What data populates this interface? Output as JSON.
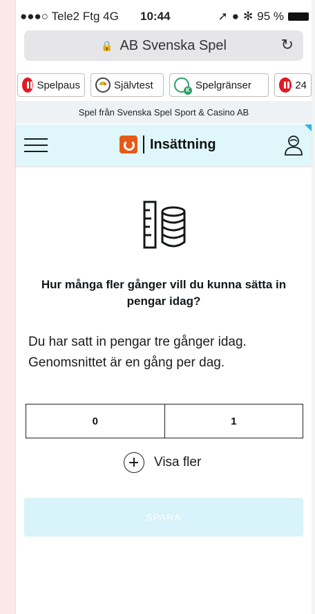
{
  "status_bar": {
    "carrier": "●●●○ Tele2 Ftg  4G",
    "time": "10:44",
    "right_text": "95 %"
  },
  "browser": {
    "site_name": "AB Svenska Spel",
    "lock_icon": "lock-icon",
    "reload_icon": "reload-icon"
  },
  "responsible_gaming": {
    "buttons": [
      {
        "label": "Spelpaus",
        "icon": "pause-icon"
      },
      {
        "label": "Självtest",
        "icon": "gauge-icon"
      },
      {
        "label": "Spelgränser",
        "icon": "limits-icon"
      },
      {
        "label": "24",
        "icon": "pause-icon"
      }
    ],
    "sponsor_text": "Spel från Svenska Spel Sport & Casino AB"
  },
  "header": {
    "title": "Insättning",
    "menu_icon": "hamburger-icon",
    "user_icon": "user-icon",
    "accent_color": "#27b6e6",
    "brand_color": "#e55a1a"
  },
  "main": {
    "question": "Hur många fler gånger vill du kunna sätta in pengar idag?",
    "info_line1": "Du har satt in pengar tre gånger idag.",
    "info_line2": "Genomsnittet är en gång per dag.",
    "options": [
      "0",
      "1"
    ],
    "show_more_label": "Visa fler",
    "save_label": "SPARA"
  }
}
